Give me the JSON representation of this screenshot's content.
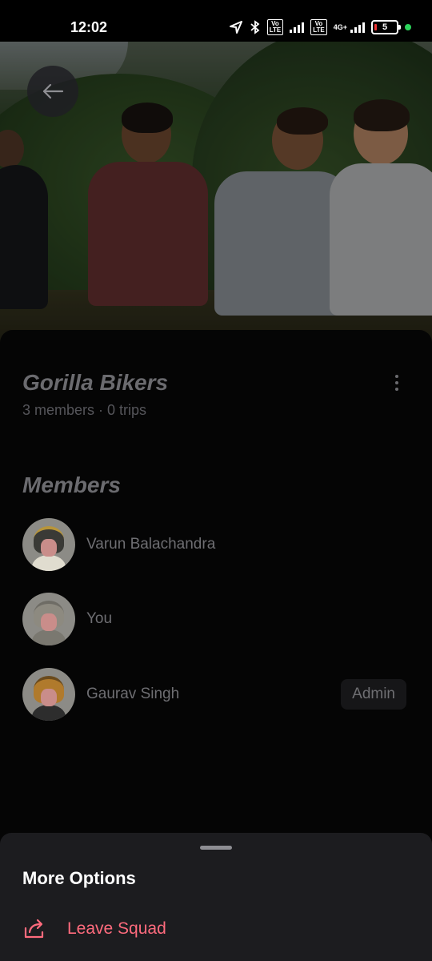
{
  "status_bar": {
    "time": "12:02",
    "network_label": "4G+",
    "volte_label_1": "Vo\nLTE",
    "volte_label_2": "Vo\nLTE",
    "battery_level": "5"
  },
  "hero": {
    "back_icon": "arrow-left-icon"
  },
  "group": {
    "name": "Gorilla Bikers",
    "subtitle": "3 members · 0 trips",
    "menu_icon": "more-vertical-icon"
  },
  "members_section": {
    "title": "Members",
    "members": [
      {
        "name": "Varun Balachandra",
        "badge": "",
        "helmet_color": "#3a3a36",
        "body_color": "#e0dccf"
      },
      {
        "name": "You",
        "badge": "",
        "helmet_color": "#8d8a80",
        "body_color": "#7a7870"
      },
      {
        "name": "Gaurav Singh",
        "badge": "Admin",
        "helmet_color": "#b07a2c",
        "body_color": "#2d2d2d"
      }
    ]
  },
  "bottom_sheet": {
    "title": "More Options",
    "leave_label": "Leave Squad",
    "leave_icon": "share-exit-icon",
    "leave_color": "#ff6b7d"
  }
}
